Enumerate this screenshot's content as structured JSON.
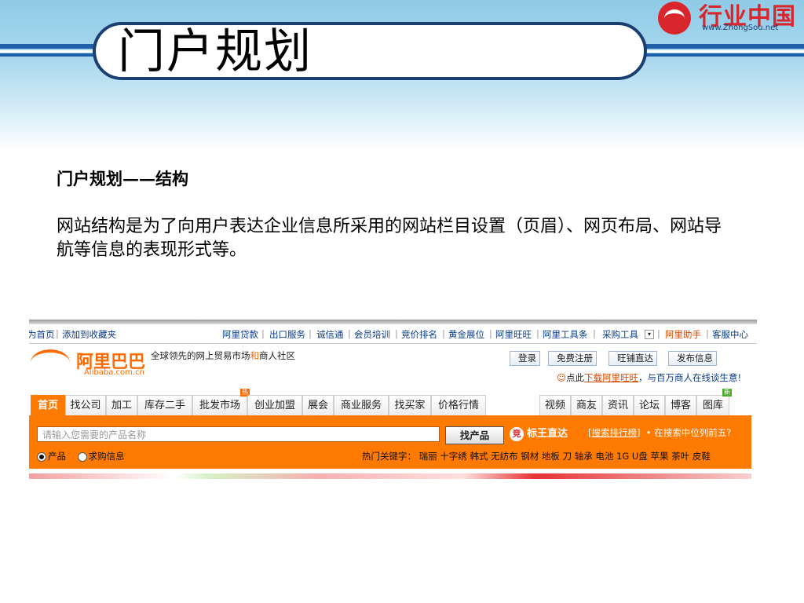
{
  "slide": {
    "title": "门户规划",
    "logo_text": "行业中国",
    "logo_url": "www.ZhongSou.net",
    "subheading": "门户规划——结构",
    "paragraph": "网站结构是为了向用户表达企业信息所采用的网站栏目设置（页眉）、网页布局、网站导航等信息的表现形式等。"
  },
  "screenshot": {
    "top_nav_left": [
      "为首页",
      "添加到收藏夹"
    ],
    "top_nav_right": [
      "阿里贷款",
      "出口服务",
      "诚信通",
      "会员培训",
      "竞价排名",
      "黄金展位",
      "阿里旺旺",
      "阿里工具条",
      "采购工具",
      "阿里助手",
      "客服中心"
    ],
    "brand_name": "阿里巴巴",
    "brand_domain": "Alibaba.com.cn",
    "slogan_a": "全球领先的网上贸易市场",
    "slogan_and": "和",
    "slogan_b": "商人社区",
    "buttons": [
      "登录",
      "免费注册",
      "旺铺直达",
      "发布信息"
    ],
    "promo_prefix": "点此",
    "promo_link": "下载阿里旺旺",
    "promo_suffix": "，与百万商人在线谈生意!",
    "tabs_left": [
      "首页",
      "找公司",
      "加工",
      "库存二手",
      "批发市场",
      "创业加盟",
      "展会",
      "商业服务",
      "找买家",
      "价格行情"
    ],
    "tabs_right": [
      "视频",
      "商友",
      "资讯",
      "论坛",
      "博客",
      "图库"
    ],
    "badge_hot": "热",
    "badge_new": "新",
    "search_placeholder": "请输入您需要的产品名称",
    "search_button": "找产品",
    "biaowang_badge": "竞",
    "biaowang": "标王直达",
    "rank_link": "[搜索排行榜]",
    "rank_tip": "• 在搜索中位列前五?",
    "radio_product": "产品",
    "radio_buy": "求购信息",
    "hot_keywords": "热门关键字：  瑞丽  十字绣  韩式  无纺布  钢材  地板  刀  轴承  电池  1G  U盘  苹果  茶叶  皮鞋"
  }
}
